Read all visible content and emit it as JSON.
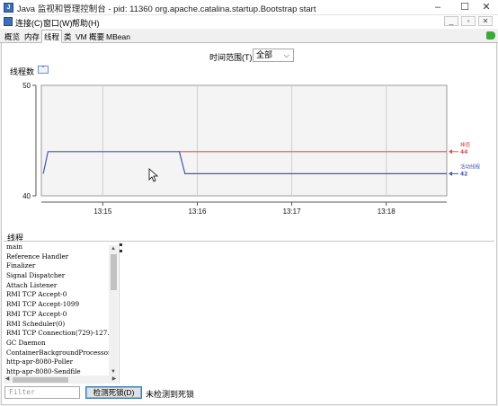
{
  "window": {
    "title": "Java 监视和管理控制台 - pid: 11360 org.apache.catalina.startup.Bootstrap start",
    "app_icon": "java-cup-icon",
    "controls": {
      "minimize": "–",
      "maximize": "☐",
      "close": "✕"
    }
  },
  "menu": {
    "items": [
      "连接(C)",
      "窗口(W)",
      "帮助(H)"
    ],
    "mdi_controls": [
      "_",
      "▫",
      "✕"
    ]
  },
  "tabs": {
    "items": [
      "概览",
      "内存",
      "线程",
      "类",
      "VM 概要",
      "MBean"
    ],
    "active": "线程",
    "status_icon": "connected-plug-icon"
  },
  "toolbar": {
    "time_range_label": "时间范围(T):",
    "time_range_value": "全部",
    "time_range_arrow": "⌵"
  },
  "thread_count": {
    "section_label": "线程数",
    "collapse_glyph": "⌃"
  },
  "chart_data": {
    "type": "line",
    "title": "线程数",
    "xlabel": "",
    "ylabel": "",
    "ylim": [
      40,
      50
    ],
    "y_ticks": [
      "50",
      "40"
    ],
    "x_ticks": [
      "13:15",
      "13:16",
      "13:17",
      "13:18"
    ],
    "x_tick_positions_min": [
      15,
      16,
      17,
      18
    ],
    "xlim": [
      14.35,
      18.64
    ],
    "grid": true,
    "legend_placement": "right",
    "series": [
      {
        "name": "峰值",
        "color": "#e05050",
        "current_value": "44",
        "points": [
          [
            15.81,
            44
          ],
          [
            18.64,
            44
          ]
        ]
      },
      {
        "name": "活动线程",
        "color": "#4455b0",
        "current_value": "42",
        "points": [
          [
            14.37,
            42
          ],
          [
            14.42,
            44
          ],
          [
            15.81,
            44
          ],
          [
            15.87,
            42
          ],
          [
            18.64,
            42
          ]
        ]
      }
    ]
  },
  "threads": {
    "section_label": "线程",
    "list": [
      "main",
      "Reference Handler",
      "Finalizer",
      "Signal Dispatcher",
      "Attach Listener",
      "RMI TCP Accept-0",
      "RMI TCP Accept-1099",
      "RMI TCP Accept-0",
      "RMI Scheduler(0)",
      "RMI TCP Connection(729)-127.0.",
      "GC Daemon",
      "ContainerBackgroundProcessor[S",
      "http-apr-8080-Poller",
      "http-apr-8080-Sendfile"
    ],
    "filter_placeholder": "Filter",
    "detect_deadlock_label": "检测死锁(D)",
    "deadlock_status": "未检测到死锁"
  }
}
